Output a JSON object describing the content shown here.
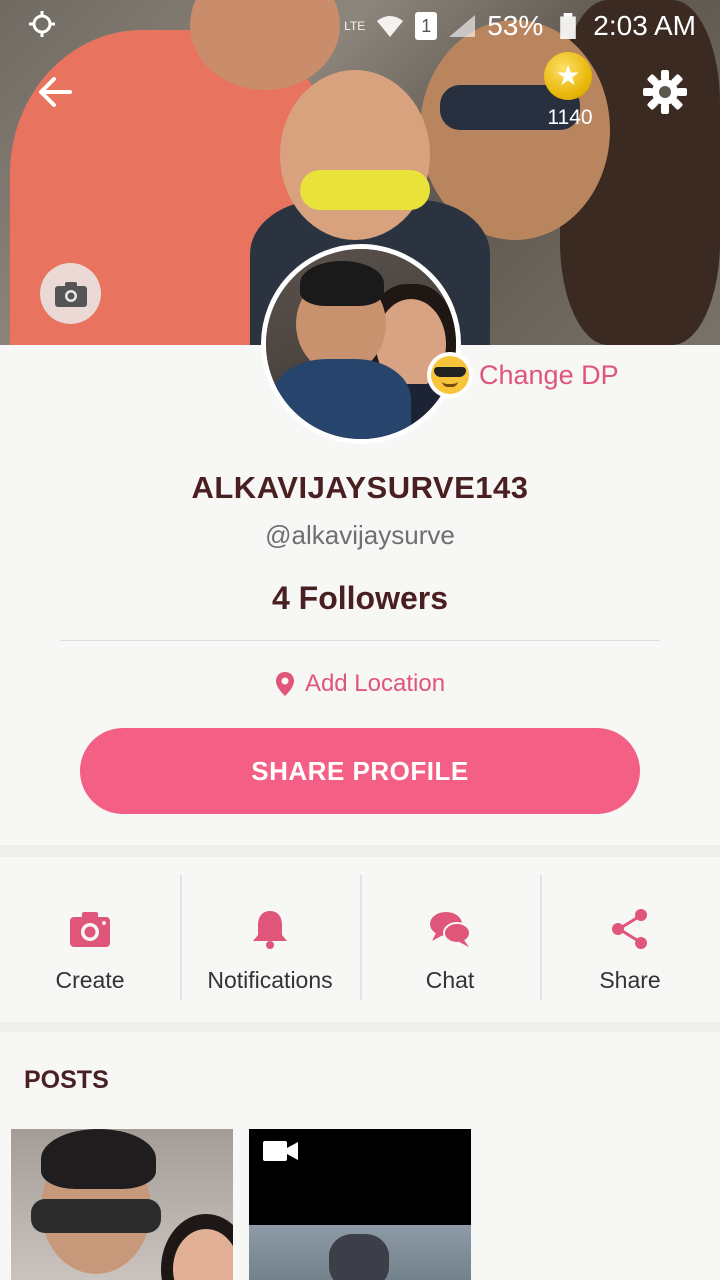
{
  "status_bar": {
    "battery": "53%",
    "time": "2:03 AM",
    "network": "LTE",
    "sim": "1"
  },
  "header": {
    "coins": "1140",
    "change_dp_label": "Change DP"
  },
  "profile": {
    "display_name": "ALKAVIJAYSURVE143",
    "handle": "@alkavijaysurve",
    "followers": "4 Followers",
    "add_location_label": "Add Location",
    "share_button_label": "SHARE PROFILE"
  },
  "actions": [
    {
      "label": "Create",
      "icon": "camera-icon"
    },
    {
      "label": "Notifications",
      "icon": "bell-icon"
    },
    {
      "label": "Chat",
      "icon": "chat-icon"
    },
    {
      "label": "Share",
      "icon": "share-icon"
    }
  ],
  "posts": {
    "title": "POSTS"
  },
  "colors": {
    "accent": "#f45f86",
    "accent_text": "#e0557a",
    "title_text": "#4a1f22"
  }
}
